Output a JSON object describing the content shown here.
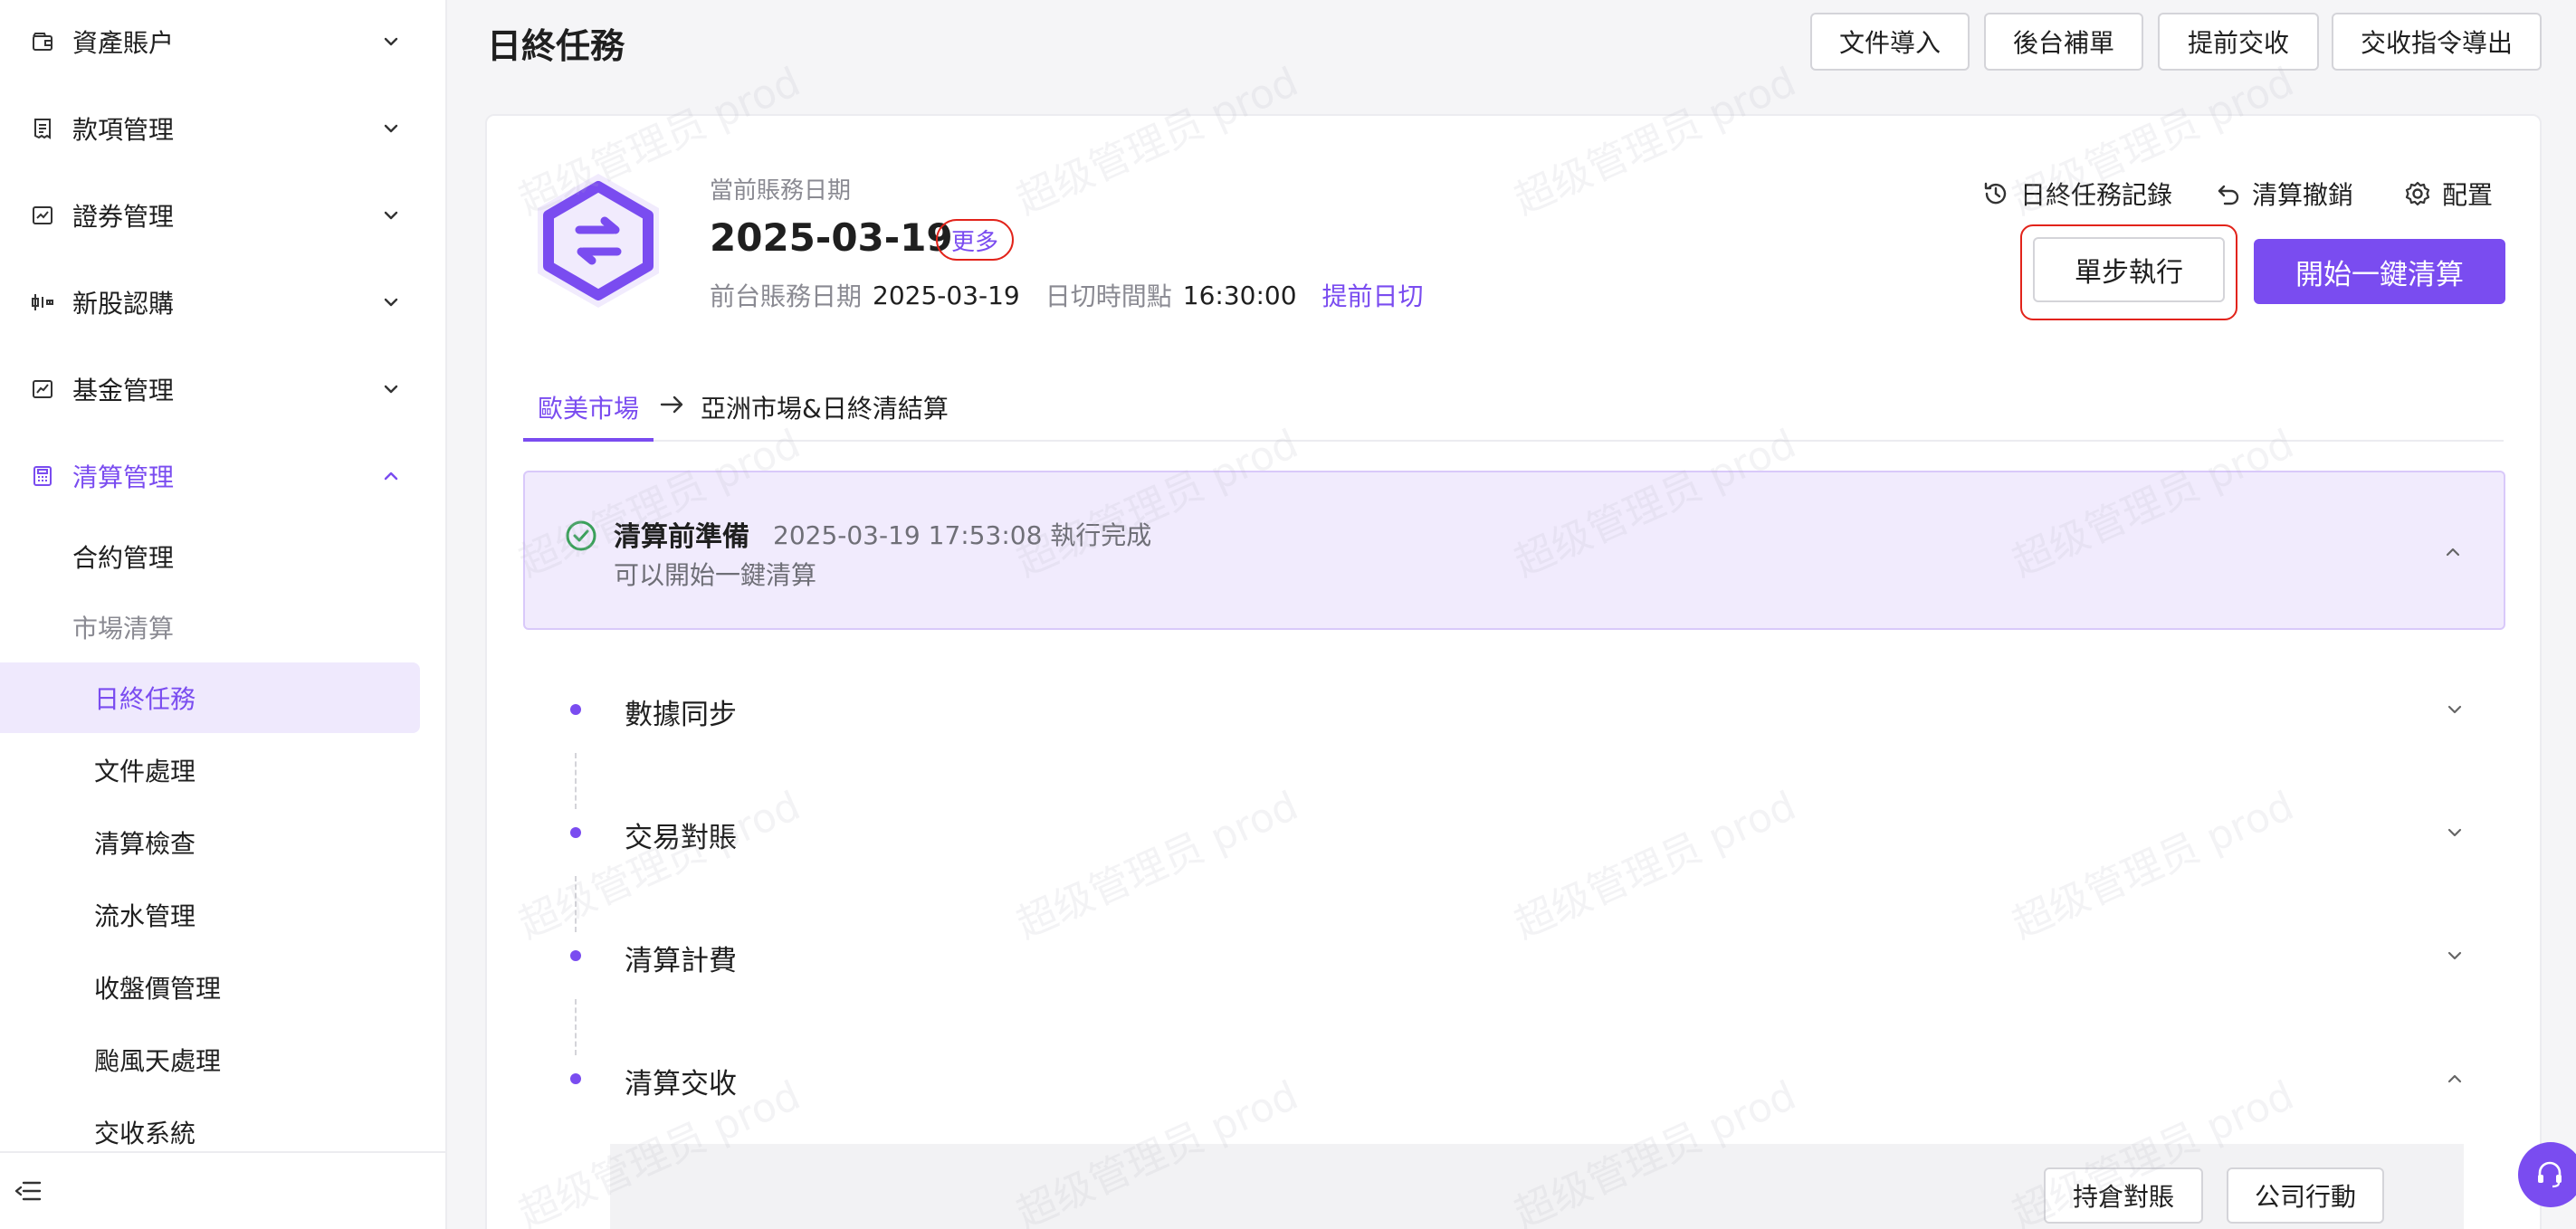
{
  "sidebar": {
    "groups": [
      {
        "label": "資產賬户",
        "icon": "wallet-icon"
      },
      {
        "label": "款項管理",
        "icon": "receipt-icon"
      },
      {
        "label": "證券管理",
        "icon": "stock-chart-icon"
      },
      {
        "label": "新股認購",
        "icon": "ipo-icon"
      },
      {
        "label": "基金管理",
        "icon": "fund-trend-icon"
      },
      {
        "label": "清算管理",
        "icon": "calculator-icon",
        "expanded": true
      }
    ],
    "clearing_items": {
      "contract": "合約管理",
      "market_clearing": "市場清算",
      "eod_tasks": "日終任務",
      "file_processing": "文件處理",
      "clearing_check": "清算檢查",
      "ledger": "流水管理",
      "closing_price": "收盤價管理",
      "typhoon": "颱風天處理",
      "settlement_system": "交收系統"
    }
  },
  "page": {
    "title": "日終任務",
    "toolbar": {
      "import": "文件導入",
      "backfill": "後台補單",
      "early_settle": "提前交收",
      "export_instructions": "交收指令導出"
    }
  },
  "account": {
    "date_label": "當前賬務日期",
    "date": "2025-03-19",
    "more": "更多",
    "front_label": "前台賬務日期",
    "front_date": "2025-03-19",
    "cutoff_label": "日切時間點",
    "cutoff_time": "16:30:00",
    "early_cut": "提前日切"
  },
  "actions": {
    "history": "日終任務記錄",
    "undo": "清算撤銷",
    "config": "配置",
    "single_step": "單步執行",
    "one_click": "開始一鍵清算"
  },
  "tabs": {
    "first": "歐美市場",
    "second": "亞洲市場&日終清結算"
  },
  "status": {
    "title": "清算前準備",
    "time": "2025-03-19 17:53:08 執行完成",
    "subtitle": "可以開始一鍵清算"
  },
  "steps": {
    "sync": "數據同步",
    "reconcile": "交易對賬",
    "fees": "清算計費",
    "settlement": "清算交收"
  },
  "sub_actions": {
    "position": "持倉對賬",
    "corporate": "公司行動"
  },
  "watermark": "超级管理员 prod",
  "colors": {
    "accent": "#7a4cf0",
    "accent_light": "#f1ebfd",
    "highlight_border": "#e2231a",
    "success": "#3aa05a"
  }
}
